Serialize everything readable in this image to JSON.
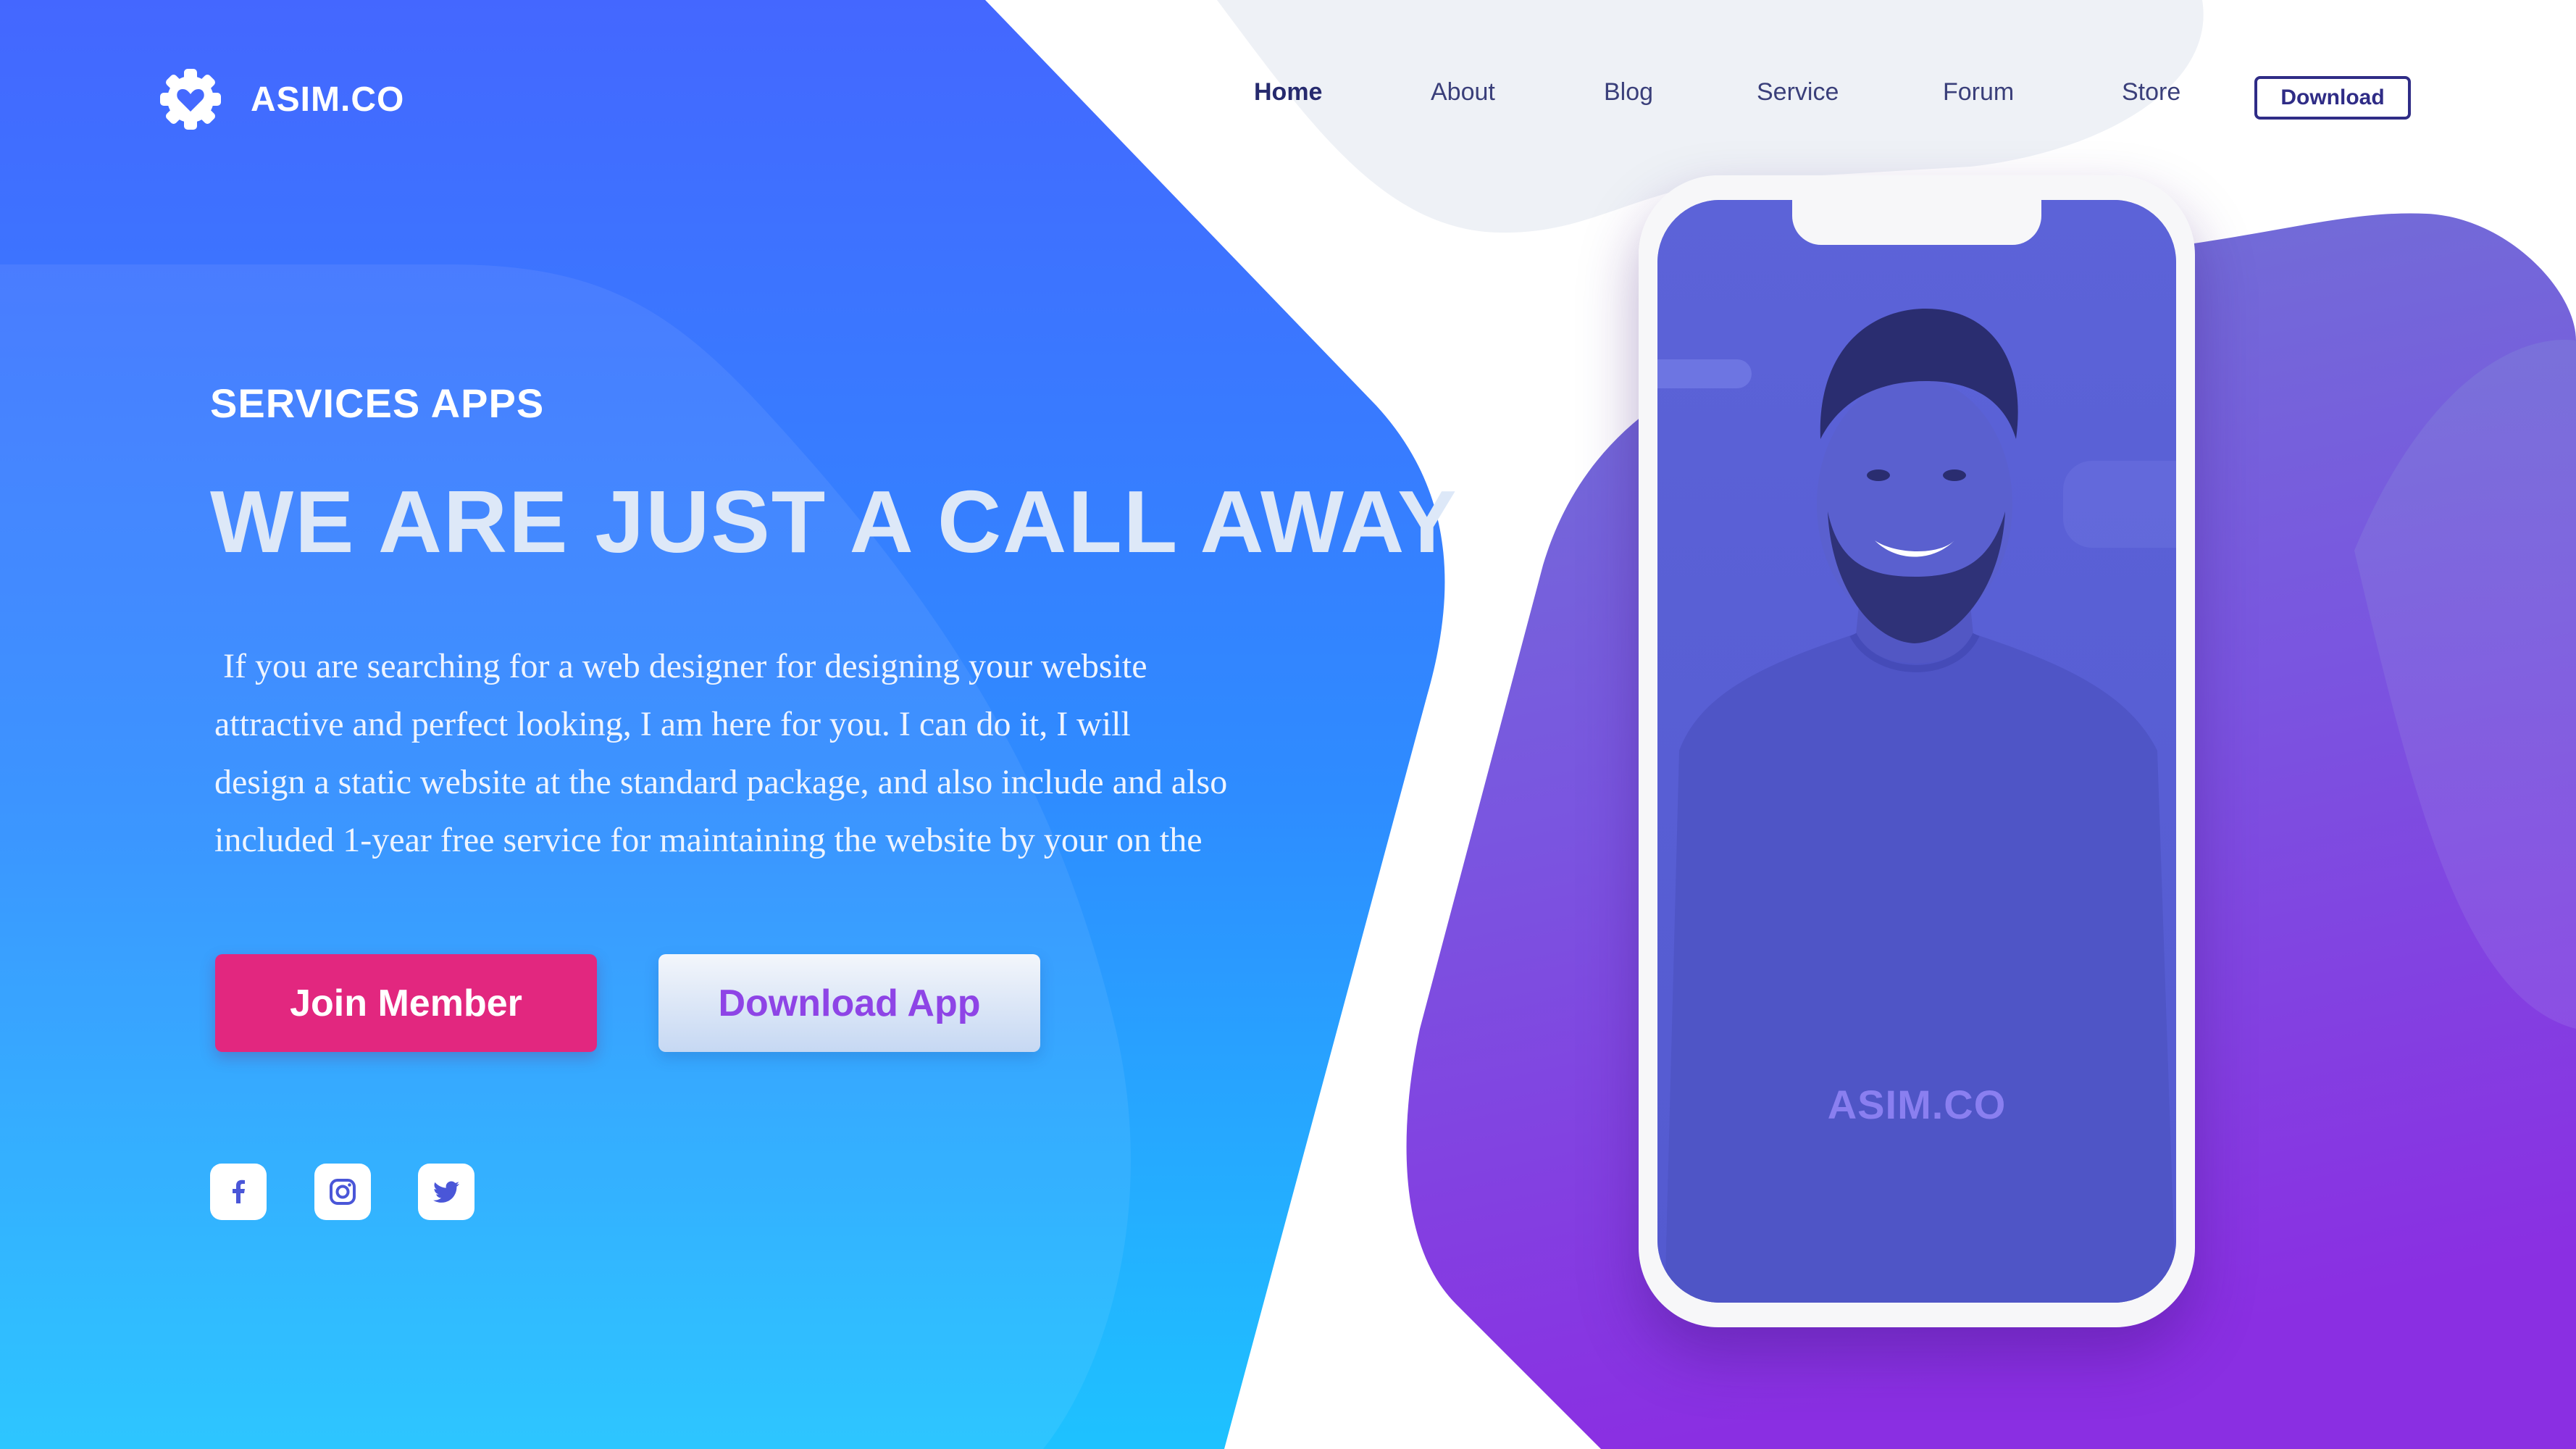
{
  "brand": {
    "name": "ASIM.CO",
    "logo_icon": "heart-gear-icon"
  },
  "nav": {
    "items": [
      {
        "label": "Home",
        "active": true
      },
      {
        "label": "About",
        "active": false
      },
      {
        "label": "Blog",
        "active": false
      },
      {
        "label": "Service",
        "active": false
      },
      {
        "label": "Forum",
        "active": false
      },
      {
        "label": "Store",
        "active": false
      }
    ],
    "download_label": "Download"
  },
  "hero": {
    "eyebrow": "SERVICES APPS",
    "headline": "WE ARE JUST A CALL AWAY",
    "body_lines": [
      " If you are searching for a web designer for designing your website",
      "attractive and perfect looking, I am here for you. I can do it, I will",
      "design a static website at the standard package, and also include and also",
      "included 1-year free service for maintaining the website by your on the"
    ],
    "join_button": "Join Member",
    "app_button": "Download App"
  },
  "social": [
    "facebook-icon",
    "instagram-icon",
    "twitter-icon"
  ],
  "phone": {
    "screen_brand": "ASIM.CO"
  },
  "colors": {
    "blue_top": "#4168ff",
    "blue_bottom": "#20c0ff",
    "purple_top": "#6a6fd8",
    "purple_bottom": "#8a2ee0",
    "join_button": "#e2277f",
    "app_button_text": "#8e44e6",
    "nav_text": "#3a3f7a"
  }
}
